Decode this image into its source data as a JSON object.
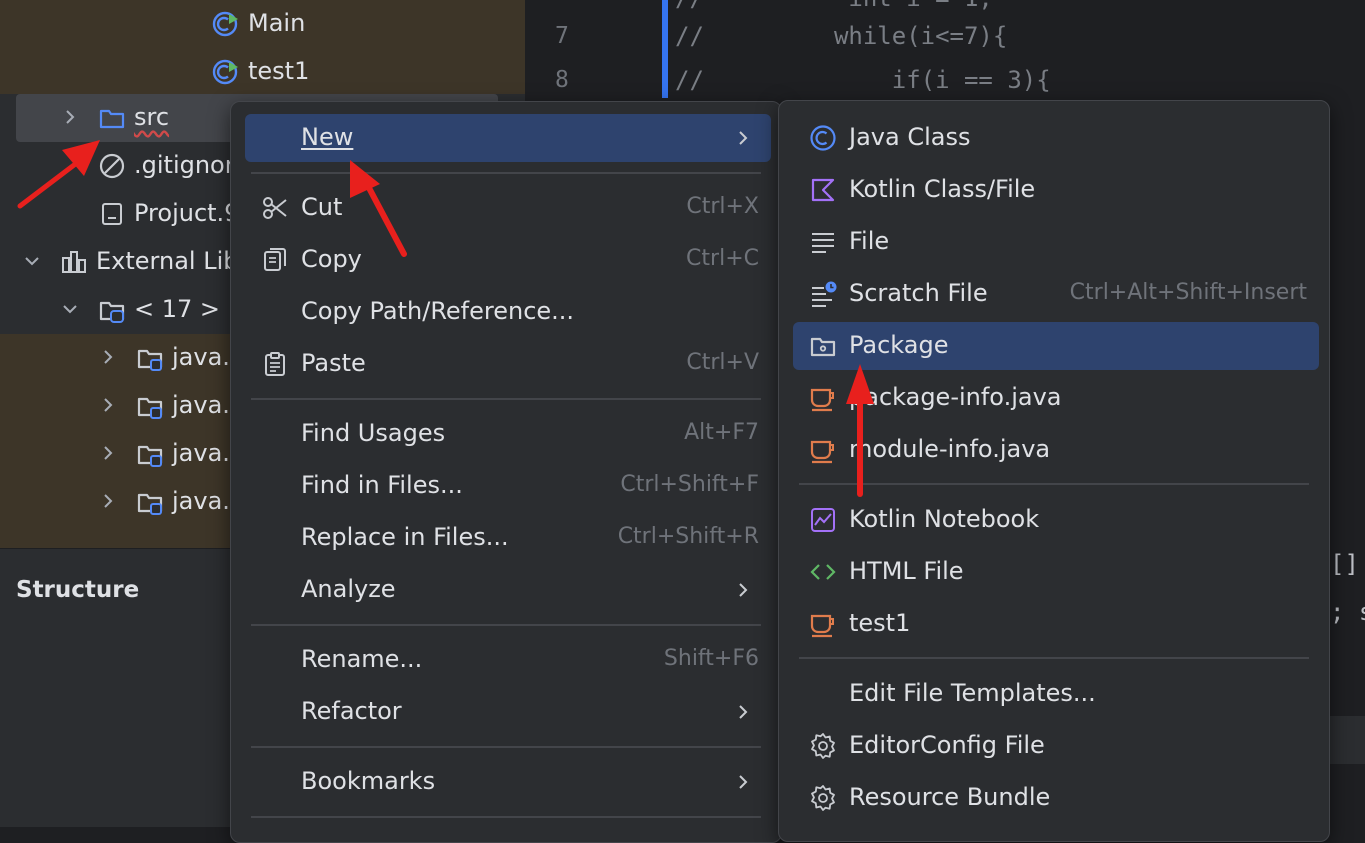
{
  "project_tree": {
    "items": [
      {
        "label": "Main",
        "icon": "java-class-run-icon"
      },
      {
        "label": "test1",
        "icon": "java-class-run-icon"
      },
      {
        "label": "src",
        "icon": "folder-icon"
      },
      {
        "label": ".gitignor",
        "icon": "ignored-file-icon"
      },
      {
        "label": "Projuct.9",
        "icon": "file-icon"
      },
      {
        "label": "External Lib",
        "icon": "libraries-icon"
      },
      {
        "label": "< 17 >",
        "icon": "jdk-folder-icon"
      },
      {
        "label": "java.b",
        "icon": "module-folder-icon"
      },
      {
        "label": "java.c",
        "icon": "module-folder-icon"
      },
      {
        "label": "java.d",
        "icon": "module-folder-icon"
      },
      {
        "label": "java.d",
        "icon": "module-folder-icon"
      }
    ]
  },
  "structure": {
    "title": "Structure"
  },
  "editor": {
    "line_numbers": [
      "7",
      "8"
    ],
    "lines": [
      "//         while(i<=7){",
      "//             if(i == 3){"
    ],
    "partial_top": "//          int i = 1;",
    "right_fragments": [
      "[]",
      "; s"
    ]
  },
  "context_menu": {
    "items": [
      {
        "label": "New",
        "shortcut": "",
        "submenu": true
      },
      {
        "label": "Cut",
        "shortcut": "Ctrl+X",
        "icon": "scissors-icon"
      },
      {
        "label": "Copy",
        "shortcut": "Ctrl+C",
        "icon": "copy-icon"
      },
      {
        "label": "Copy Path/Reference...",
        "shortcut": ""
      },
      {
        "label": "Paste",
        "shortcut": "Ctrl+V",
        "icon": "clipboard-icon"
      },
      {
        "label": "Find Usages",
        "shortcut": "Alt+F7"
      },
      {
        "label": "Find in Files...",
        "shortcut": "Ctrl+Shift+F"
      },
      {
        "label": "Replace in Files...",
        "shortcut": "Ctrl+Shift+R"
      },
      {
        "label": "Analyze",
        "shortcut": "",
        "submenu": true
      },
      {
        "label": "Rename...",
        "shortcut": "Shift+F6"
      },
      {
        "label": "Refactor",
        "shortcut": "",
        "submenu": true
      },
      {
        "label": "Bookmarks",
        "shortcut": "",
        "submenu": true
      }
    ]
  },
  "new_submenu": {
    "items": [
      {
        "label": "Java Class",
        "icon": "java-class-icon"
      },
      {
        "label": "Kotlin Class/File",
        "icon": "kotlin-icon"
      },
      {
        "label": "File",
        "icon": "text-file-icon"
      },
      {
        "label": "Scratch File",
        "shortcut": "Ctrl+Alt+Shift+Insert",
        "icon": "scratch-file-icon"
      },
      {
        "label": "Package",
        "icon": "package-icon"
      },
      {
        "label": "package-info.java",
        "icon": "java-cup-icon"
      },
      {
        "label": "module-info.java",
        "icon": "java-cup-icon"
      },
      {
        "label": "Kotlin Notebook",
        "icon": "notebook-icon"
      },
      {
        "label": "HTML File",
        "icon": "html-icon"
      },
      {
        "label": "test1",
        "icon": "java-cup-icon"
      },
      {
        "label": "Edit File Templates..."
      },
      {
        "label": "EditorConfig File",
        "icon": "gear-icon"
      },
      {
        "label": "Resource Bundle",
        "icon": "gear-icon"
      }
    ]
  },
  "colors": {
    "highlight": "#2e436e",
    "accent": "#3574f0",
    "annotation_arrow": "#e8201d"
  }
}
